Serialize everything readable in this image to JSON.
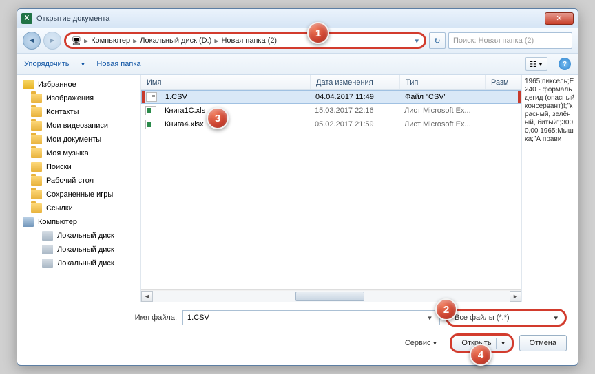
{
  "title": "Открытие документа",
  "breadcrumb": [
    "Компьютер",
    "Локальный диск (D:)",
    "Новая папка (2)"
  ],
  "search_placeholder": "Поиск: Новая папка (2)",
  "toolbar": {
    "organize": "Упорядочить",
    "newfolder": "Новая папка"
  },
  "sidebar": [
    {
      "label": "Избранное",
      "icon": "star",
      "root": true
    },
    {
      "label": "Изображения",
      "icon": "fold"
    },
    {
      "label": "Контакты",
      "icon": "fold"
    },
    {
      "label": "Мои видеозаписи",
      "icon": "fold"
    },
    {
      "label": "Мои документы",
      "icon": "fold"
    },
    {
      "label": "Моя музыка",
      "icon": "fold"
    },
    {
      "label": "Поиски",
      "icon": "srch"
    },
    {
      "label": "Рабочий стол",
      "icon": "fold"
    },
    {
      "label": "Сохраненные игры",
      "icon": "fold"
    },
    {
      "label": "Ссылки",
      "icon": "fold"
    },
    {
      "label": "Компьютер",
      "icon": "comp",
      "root": true
    },
    {
      "label": "Локальный диск",
      "icon": "drive",
      "indent": true
    },
    {
      "label": "Локальный диск",
      "icon": "drive",
      "indent": true
    },
    {
      "label": "Локальный диск",
      "icon": "drive",
      "indent": true
    }
  ],
  "columns": {
    "name": "Имя",
    "date": "Дата изменения",
    "type": "Тип",
    "size": "Разм"
  },
  "files": [
    {
      "name": "1.CSV",
      "date": "04.04.2017 11:49",
      "type": "Файл \"CSV\"",
      "icon": "csv",
      "sel": true
    },
    {
      "name": "Книга1C.xls",
      "date": "15.03.2017 22:16",
      "type": "Лист Microsoft Ex...",
      "icon": "xls"
    },
    {
      "name": "Книга4.xlsx",
      "date": "05.02.2017 21:59",
      "type": "Лист Microsoft Ex...",
      "icon": "xls"
    }
  ],
  "preview_text": "1965;пиксель;E240 - формальдегид (опасный консервант)!;\"красный, зелёный, битый\";3000,00\n1965;Мышка;\"А прави",
  "filename_label": "Имя файла:",
  "filename_value": "1.CSV",
  "filter": "Все файлы (*.*)",
  "service": "Сервис",
  "open": "Открыть",
  "cancel": "Отмена",
  "callouts": {
    "1": "1",
    "2": "2",
    "3": "3",
    "4": "4"
  }
}
